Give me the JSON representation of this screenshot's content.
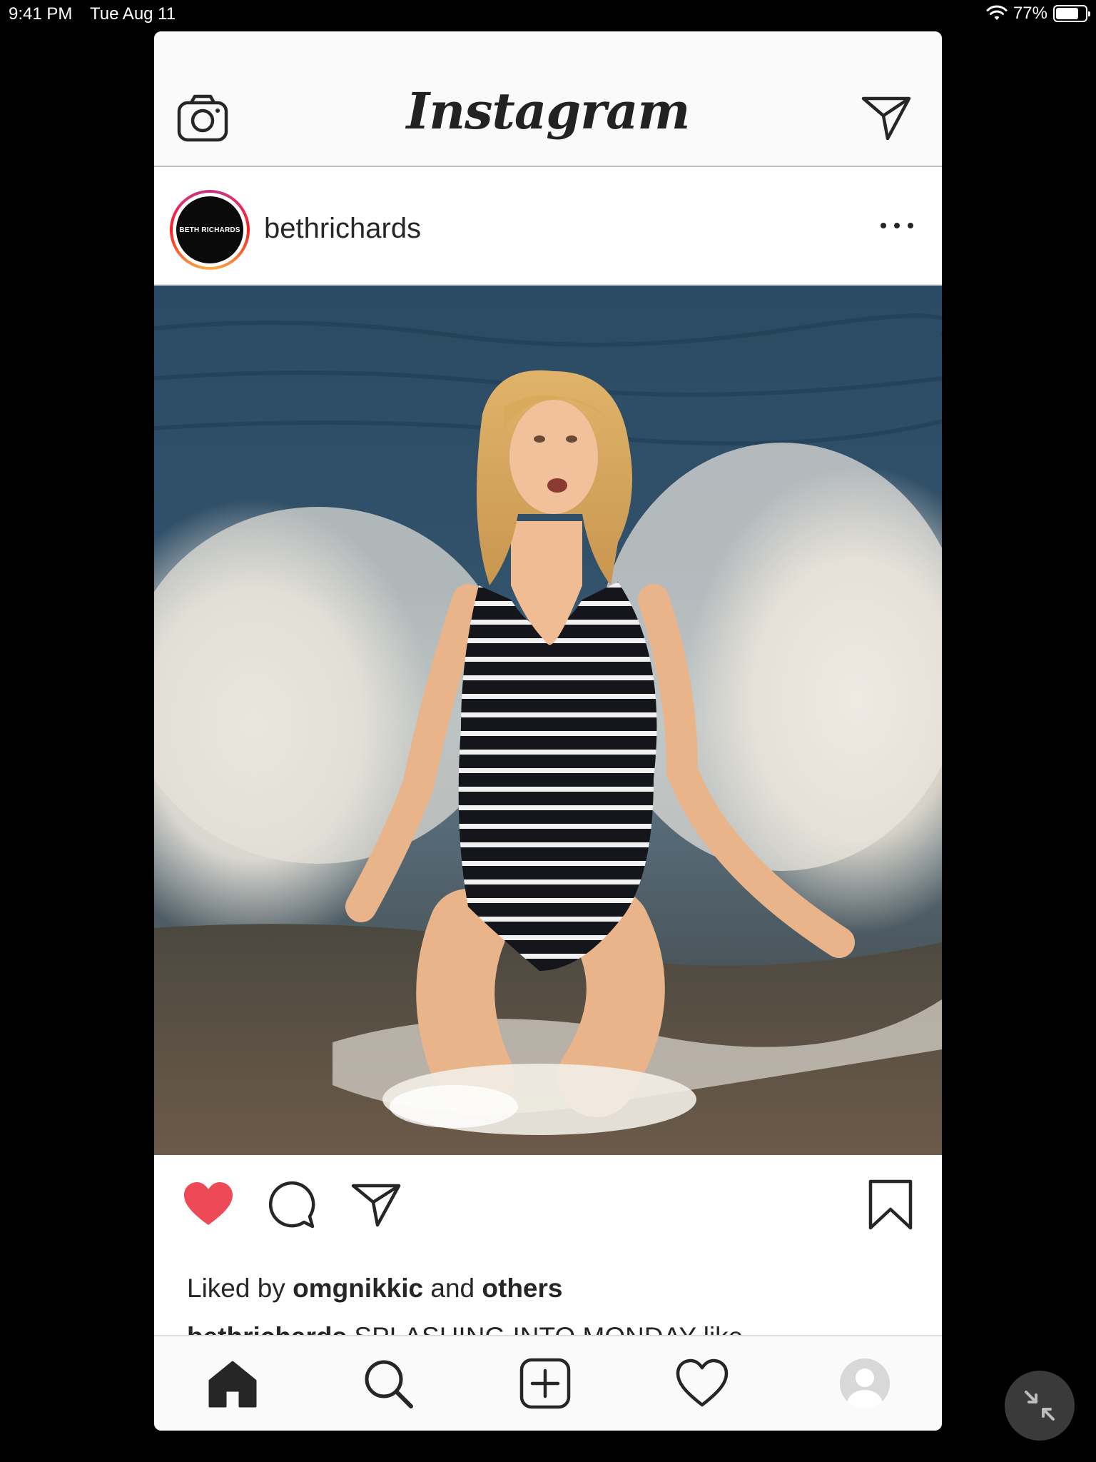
{
  "status_bar": {
    "time": "9:41 PM",
    "date": "Tue Aug 11",
    "battery": "77%",
    "battery_level": 0.77,
    "icons": [
      "wifi-icon",
      "battery-icon"
    ]
  },
  "header": {
    "logo": "Instagram",
    "left_icon": "camera-icon",
    "right_icon": "paper-plane-icon"
  },
  "post": {
    "username": "bethrichards",
    "avatar_text": "BETH RICHARDS",
    "more_icon": "ellipsis-icon",
    "photo_description": "woman in striped swimsuit kneeling in ocean waves",
    "actions": {
      "like_icon": "heart-icon",
      "liked": true,
      "comment_icon": "comment-icon",
      "share_icon": "paper-plane-icon",
      "save_icon": "bookmark-icon"
    },
    "likes": {
      "prefix": "Liked by ",
      "user": "omgnikkic",
      "connector": " and ",
      "others": "others"
    },
    "caption": {
      "username": "bethrichards",
      "text": " SPLASHING INTO MONDAY like"
    }
  },
  "tab_bar": {
    "tabs": [
      "home-icon",
      "search-icon",
      "new-post-icon",
      "activity-heart-icon",
      "profile-icon"
    ],
    "active": "home-icon"
  },
  "colors": {
    "like_red": "#ed4956",
    "text": "#262626",
    "accent_ring": [
      "#c13584",
      "#e1306c",
      "#fd1d1d",
      "#f77737",
      "#fcaf45"
    ]
  }
}
